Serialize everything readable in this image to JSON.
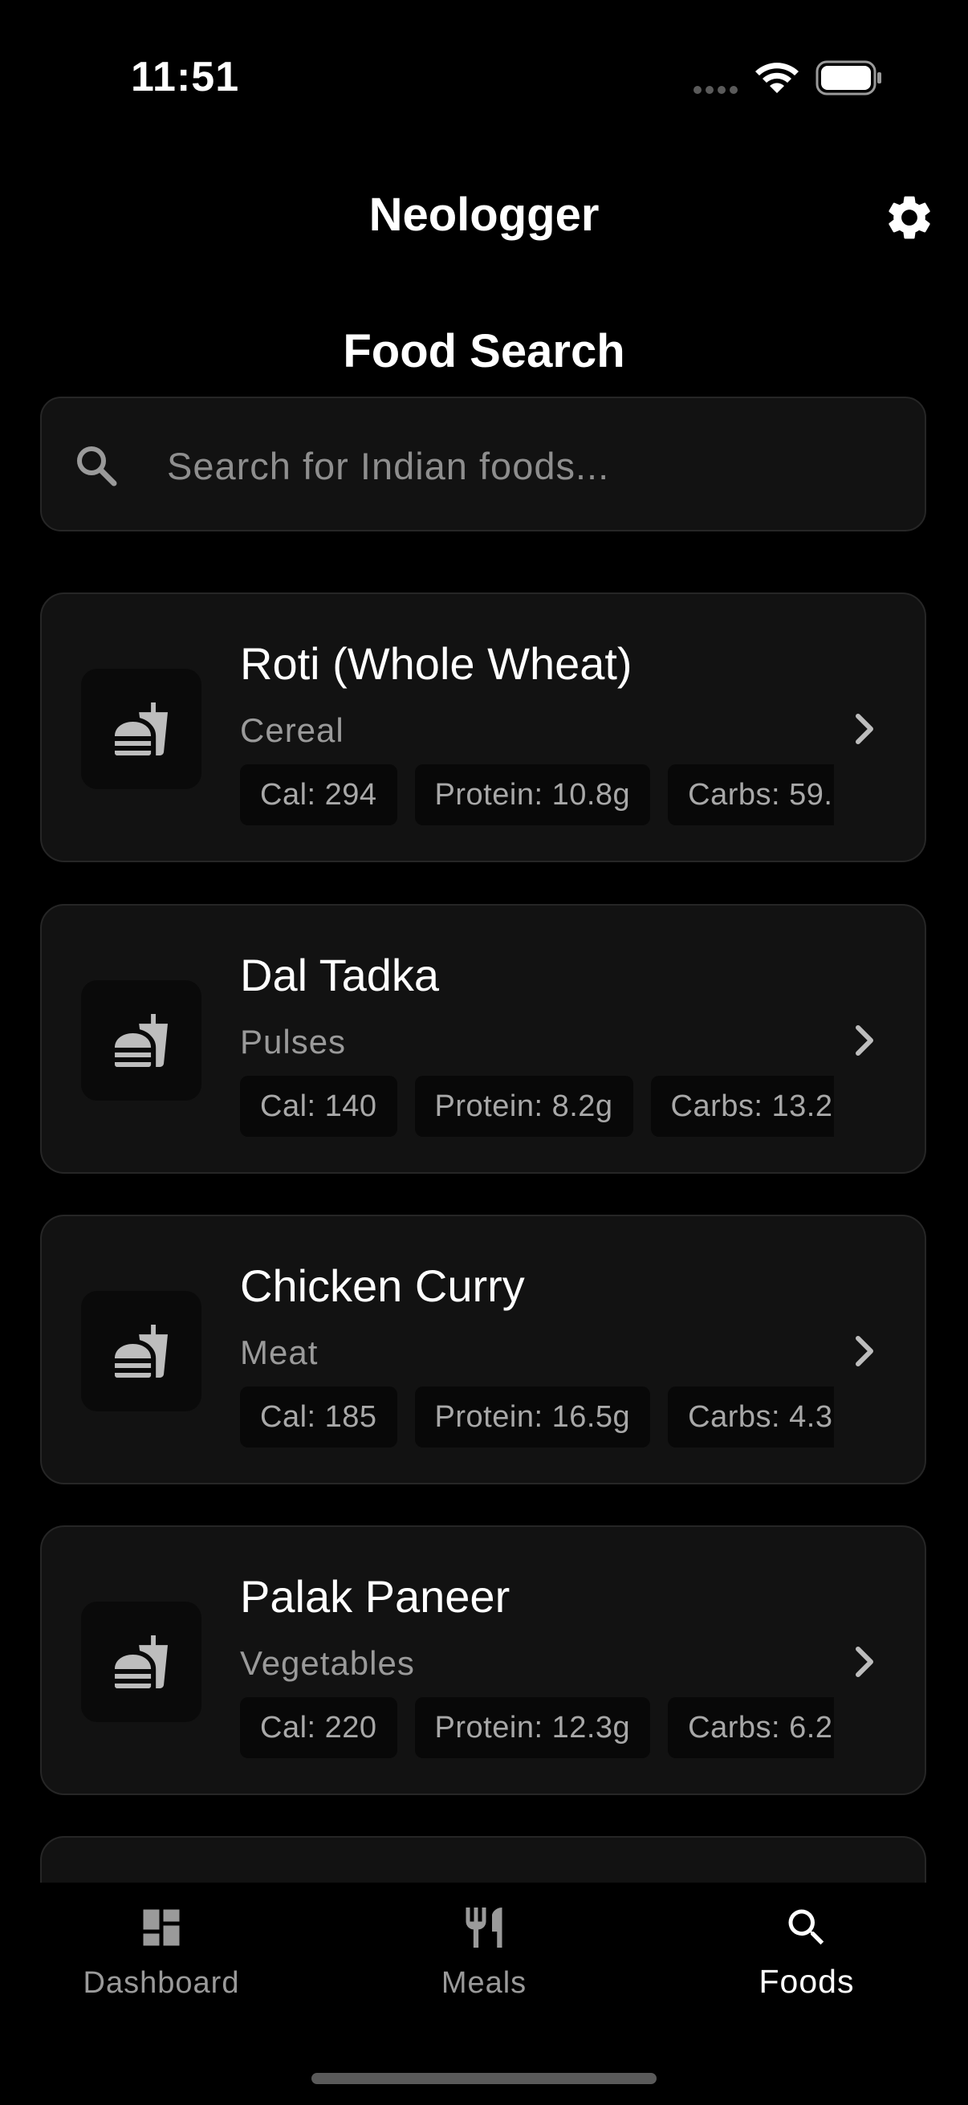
{
  "status_bar": {
    "time": "11:51"
  },
  "header": {
    "title": "Neologger",
    "settings_icon": "gear-icon"
  },
  "section": {
    "title": "Food Search"
  },
  "search": {
    "placeholder": "Search for Indian foods...",
    "value": "",
    "icon": "search-icon"
  },
  "foods": [
    {
      "name": "Roti (Whole Wheat)",
      "category": "Cereal",
      "calories": "Cal: 294",
      "protein": "Protein: 10.8g",
      "carbs": "Carbs: 59.",
      "icon": "fastfood-icon"
    },
    {
      "name": "Dal Tadka",
      "category": "Pulses",
      "calories": "Cal: 140",
      "protein": "Protein: 8.2g",
      "carbs": "Carbs: 13.2",
      "icon": "fastfood-icon"
    },
    {
      "name": "Chicken Curry",
      "category": "Meat",
      "calories": "Cal: 185",
      "protein": "Protein: 16.5g",
      "carbs": "Carbs: 4.3",
      "icon": "fastfood-icon"
    },
    {
      "name": "Palak Paneer",
      "category": "Vegetables",
      "calories": "Cal: 220",
      "protein": "Protein: 12.3g",
      "carbs": "Carbs: 6.2",
      "icon": "fastfood-icon"
    }
  ],
  "nav": {
    "items": [
      {
        "label": "Dashboard",
        "icon": "dashboard-icon",
        "active": false
      },
      {
        "label": "Meals",
        "icon": "fork-knife-icon",
        "active": false
      },
      {
        "label": "Foods",
        "icon": "search-icon",
        "active": true
      }
    ]
  },
  "colors": {
    "background": "#000000",
    "card": "#121212",
    "border": "#262626",
    "muted_text": "#9a9a9a"
  }
}
